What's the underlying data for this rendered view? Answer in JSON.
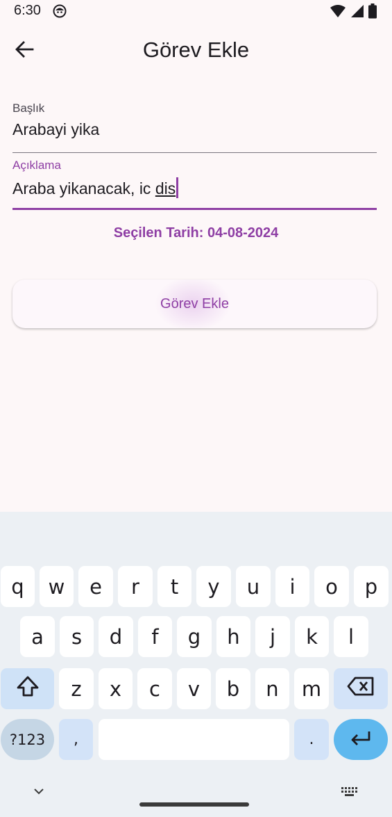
{
  "status_bar": {
    "time": "6:30",
    "icons": [
      "app-notification-icon",
      "wifi-icon",
      "signal-icon",
      "battery-icon"
    ]
  },
  "app_bar": {
    "title": "Görev Ekle",
    "back_icon": "arrow-back-icon"
  },
  "form": {
    "title_field": {
      "label": "Başlık",
      "value": "Arabayi yika"
    },
    "description_field": {
      "label": "Açıklama",
      "value_prefix": "Araba yikanacak, ic ",
      "composing_text": "dis"
    },
    "selected_date": "Seçilen Tarih: 04-08-2024",
    "submit_label": "Görev Ekle"
  },
  "keyboard": {
    "row1": [
      "q",
      "w",
      "e",
      "r",
      "t",
      "y",
      "u",
      "i",
      "o",
      "p"
    ],
    "row2": [
      "a",
      "s",
      "d",
      "f",
      "g",
      "h",
      "j",
      "k",
      "l"
    ],
    "row3": [
      "z",
      "x",
      "c",
      "v",
      "b",
      "n",
      "m"
    ],
    "symbols_label": "?123",
    "comma_label": ",",
    "period_label": ".",
    "shift_icon": "shift-icon",
    "backspace_icon": "backspace-icon",
    "enter_icon": "enter-icon",
    "hide_icon": "chevron-down-icon",
    "layout_icon": "keyboard-grid-icon"
  },
  "colors": {
    "accent": "#8e3ea4",
    "background": "#fdf7f8",
    "keyboard_bg": "#ecf0f4",
    "enter_key": "#5eb8ee"
  }
}
